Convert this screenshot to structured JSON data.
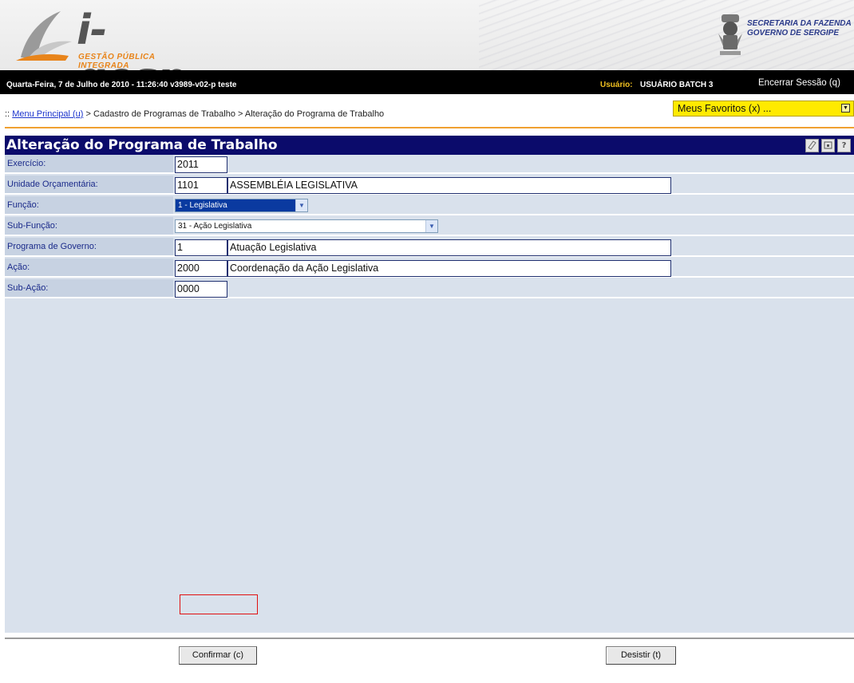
{
  "header": {
    "logo_text": "i-gesp",
    "logo_subtitle": "GESTÃO PÚBLICA INTEGRADA",
    "secretaria_line1": "SECRETARIA DA FAZENDA",
    "secretaria_line2": "GOVERNO DE SERGIPE"
  },
  "status_bar": {
    "date_text": "Quarta-Feira, 7 de Julho de 2010 - 11:26:40  v3989-v02-p  teste",
    "user_label": "Usuário:",
    "user_name": "USUÁRIO BATCH 3",
    "logout": "Encerrar Sessão (q)"
  },
  "breadcrumb": {
    "prefix": "::",
    "home": "Menu Principal (u)",
    "separator": ">",
    "level1": "Cadastro de Programas de Trabalho",
    "level2": "Alteração do Programa de Trabalho"
  },
  "favorites": {
    "label": "Meus Favoritos (x) ...",
    "icon": "dropdown-arrow-icon"
  },
  "panel": {
    "title": "Alteração do Programa de Trabalho",
    "icons": [
      "eraser-icon",
      "print-icon",
      "help-icon"
    ],
    "help_glyph": "?"
  },
  "form": {
    "exercicio": {
      "label": "Exercício:",
      "value": "2011"
    },
    "unidade": {
      "label": "Unidade Orçamentária:",
      "code": "1101",
      "name": "ASSEMBLÉIA LEGISLATIVA"
    },
    "funcao": {
      "label": "Função:",
      "selected": "1 - Legislativa"
    },
    "subfuncao": {
      "label": "Sub-Função:",
      "selected": "31 - Ação Legislativa"
    },
    "programa": {
      "label": "Programa de Governo:",
      "code": "1",
      "name": "Atuação Legislativa"
    },
    "acao": {
      "label": "Ação:",
      "code": "2000",
      "name": "Coordenação da Ação Legislativa"
    },
    "subacao": {
      "label": "Sub-Ação:",
      "value": "0000"
    }
  },
  "buttons": {
    "confirm": "Confirmar (c)",
    "cancel": "Desistir (t)"
  },
  "colors": {
    "title_bar": "#0b0b6b",
    "favorites": "#ffea00",
    "label_text": "#1a2a8a",
    "panel_bg": "#d9e1ec",
    "accent_rule": "#f0a030"
  }
}
